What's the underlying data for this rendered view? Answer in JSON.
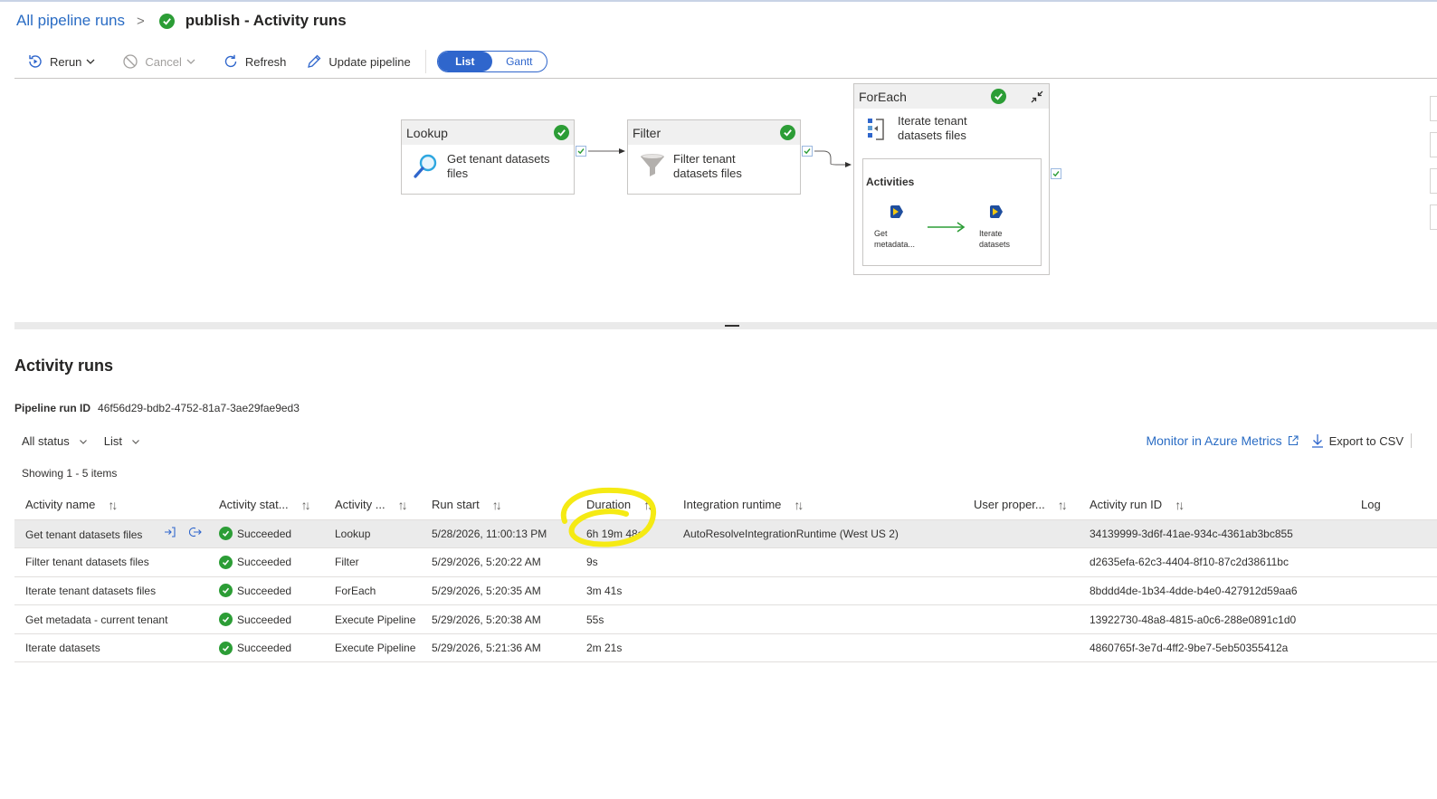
{
  "breadcrumb": {
    "link": "All pipeline runs",
    "separator": ">",
    "title": "publish - Activity runs"
  },
  "toolbar": {
    "rerun": "Rerun",
    "cancel": "Cancel",
    "refresh": "Refresh",
    "update_pipeline": "Update pipeline",
    "view_toggle": {
      "list": "List",
      "gantt": "Gantt",
      "active": "List"
    }
  },
  "diagram": {
    "lookup": {
      "header": "Lookup",
      "text_line1": "Get tenant datasets",
      "text_line2": "files"
    },
    "filter": {
      "header": "Filter",
      "text_line1": "Filter tenant",
      "text_line2": "datasets files"
    },
    "foreach": {
      "header": "ForEach",
      "text_line1": "Iterate tenant",
      "text_line2": "datasets files",
      "activities_label": "Activities",
      "sub1_line1": "Get",
      "sub1_line2": "metadata...",
      "sub2_line1": "Iterate",
      "sub2_line2": "datasets"
    }
  },
  "activity_runs": {
    "title": "Activity runs",
    "pipeline_run_id_label": "Pipeline run ID",
    "pipeline_run_id": "46f56d29-bdb2-4752-81a7-3ae29fae9ed3",
    "status_filter": "All status",
    "view_filter": "List",
    "monitor_link": "Monitor in Azure Metrics",
    "export": "Export to CSV",
    "showing": "Showing 1 - 5 items",
    "columns": {
      "name": "Activity name",
      "status": "Activity stat...",
      "type": "Activity ...",
      "run_start": "Run start",
      "duration": "Duration",
      "runtime": "Integration runtime",
      "user_props": "User proper...",
      "run_id": "Activity run ID",
      "log": "Log"
    },
    "rows": [
      {
        "name": "Get tenant datasets files",
        "status": "Succeeded",
        "type": "Lookup",
        "run_start": "5/28/2026, 11:00:13 PM",
        "duration": "6h 19m 48s",
        "runtime": "AutoResolveIntegrationRuntime (West US 2)",
        "user_props": "",
        "run_id": "34139999-3d6f-41ae-934c-4361ab3bc855"
      },
      {
        "name": "Filter tenant datasets files",
        "status": "Succeeded",
        "type": "Filter",
        "run_start": "5/29/2026, 5:20:22 AM",
        "duration": "9s",
        "runtime": "",
        "user_props": "",
        "run_id": "d2635efa-62c3-4404-8f10-87c2d38611bc"
      },
      {
        "name": "Iterate tenant datasets files",
        "status": "Succeeded",
        "type": "ForEach",
        "run_start": "5/29/2026, 5:20:35 AM",
        "duration": "3m 41s",
        "runtime": "",
        "user_props": "",
        "run_id": "8bddd4de-1b34-4dde-b4e0-427912d59aa6"
      },
      {
        "name": "Get metadata - current tenant",
        "status": "Succeeded",
        "type": "Execute Pipeline",
        "run_start": "5/29/2026, 5:20:38 AM",
        "duration": "55s",
        "runtime": "",
        "user_props": "",
        "run_id": "13922730-48a8-4815-a0c6-288e0891c1d0"
      },
      {
        "name": "Iterate datasets",
        "status": "Succeeded",
        "type": "Execute Pipeline",
        "run_start": "5/29/2026, 5:21:36 AM",
        "duration": "2m 21s",
        "runtime": "",
        "user_props": "",
        "run_id": "4860765f-3e7d-4ff2-9be7-5eb50355412a"
      }
    ]
  },
  "colors": {
    "accent": "#2f66cc",
    "link": "#2a6cc4",
    "success": "#2c9d36",
    "highlight_annotation": "#f5ea14"
  },
  "icons": [
    "rerun-icon",
    "cancel-icon",
    "refresh-icon",
    "edit-icon",
    "check-icon",
    "search-icon",
    "funnel-icon",
    "foreach-icon",
    "execute-pipeline-icon",
    "external-link-icon",
    "download-icon",
    "chevron-down-icon",
    "sort-icon"
  ]
}
